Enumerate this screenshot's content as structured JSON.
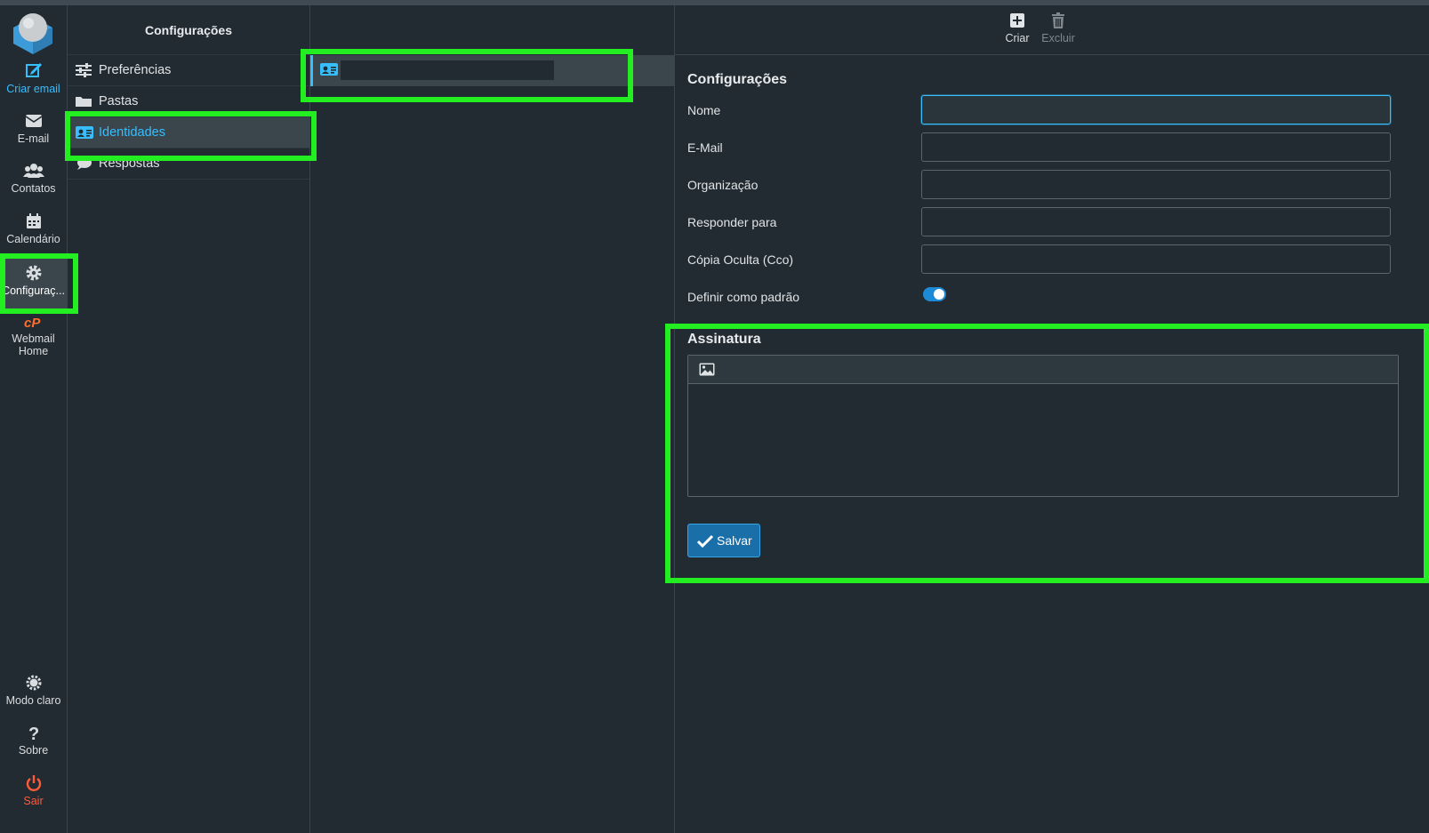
{
  "rail": {
    "top_items": [
      {
        "label": "Criar email",
        "icon": "compose-icon",
        "state": "active"
      },
      {
        "label": "E-mail",
        "icon": "envelope-icon",
        "state": ""
      },
      {
        "label": "Contatos",
        "icon": "users-icon",
        "state": ""
      },
      {
        "label": "Calendário",
        "icon": "calendar-icon",
        "state": ""
      },
      {
        "label": "Configuraç...",
        "icon": "gear-icon",
        "state": "selected"
      },
      {
        "label": "Webmail Home",
        "icon": "cpanel-icon",
        "state": ""
      }
    ],
    "bottom_items": [
      {
        "label": "Modo claro",
        "icon": "sun-icon"
      },
      {
        "label": "Sobre",
        "icon": "question-icon"
      },
      {
        "label": "Sair",
        "icon": "power-icon"
      }
    ]
  },
  "settings_nav": {
    "title": "Configurações",
    "items": [
      {
        "label": "Preferências",
        "icon": "sliders-icon"
      },
      {
        "label": "Pastas",
        "icon": "folder-icon"
      },
      {
        "label": "Identidades",
        "icon": "id-card-icon",
        "selected": true
      },
      {
        "label": "Respostas",
        "icon": "chat-icon"
      }
    ]
  },
  "identities": {
    "items": [
      {
        "name": "",
        "icon": "id-card-icon"
      }
    ]
  },
  "toolbar": {
    "create_label": "Criar",
    "delete_label": "Excluir"
  },
  "form": {
    "section_title": "Configurações",
    "fields": [
      {
        "label": "Nome",
        "value": ""
      },
      {
        "label": "E-Mail",
        "value": ""
      },
      {
        "label": "Organização",
        "value": ""
      },
      {
        "label": "Responder para",
        "value": ""
      },
      {
        "label": "Cópia Oculta (Cco)",
        "value": ""
      }
    ],
    "default_label": "Definir como padrão",
    "default_on": true,
    "signature_title": "Assinatura",
    "signature_value": "",
    "save_label": "Salvar"
  },
  "colors": {
    "background": "#222b31",
    "accent": "#37beff",
    "selected_bg": "#3a454c",
    "danger": "#ff5a3a",
    "highlight": "#22ee22"
  }
}
